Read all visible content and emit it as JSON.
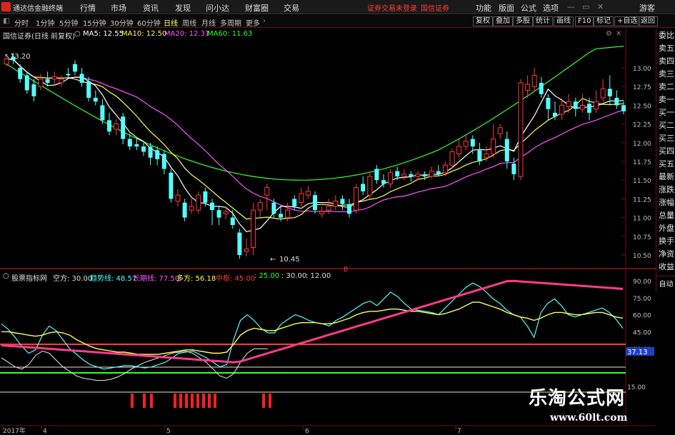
{
  "app": {
    "title": "通达信金融终端",
    "menu": [
      "行情",
      "市场",
      "资讯",
      "发现",
      "问小达",
      "财富圈",
      "交易"
    ],
    "notice_login": "证券交易未登录",
    "notice_broker": "国信证券",
    "right_menu": [
      "功能",
      "版面",
      "公式",
      "选项"
    ],
    "guest": "游客"
  },
  "periods": {
    "items": [
      "分时",
      "1分钟",
      "5分钟",
      "15分钟",
      "30分钟",
      "60分钟",
      "日线",
      "周线",
      "月线",
      "多周期",
      "更多"
    ],
    "active": "日线",
    "buttons": [
      "复权",
      "叠加",
      "多股",
      "统计",
      "画线",
      "F10",
      "标记",
      "+自选",
      "返回"
    ]
  },
  "right_panel": {
    "items": [
      "委比",
      "卖五",
      "卖四",
      "卖三",
      "卖二",
      "卖一",
      "买一",
      "买二",
      "买三",
      "买四",
      "买五",
      "最新",
      "涨跌",
      "涨幅",
      "总量",
      "外盘",
      "换手",
      "净资",
      "收益"
    ],
    "auto": "自动"
  },
  "price_chart": {
    "stock": "国信证券(日线 前复权)",
    "ma5": "MA5: 12.55",
    "ma10": "MA10: 12.50",
    "ma20": "MA20: 12.31",
    "ma60": "MA60: 11.63",
    "high_label": "13.20",
    "low_label": "10.45",
    "marker": "B",
    "y_ticks": [
      "13.00",
      "12.75",
      "12.50",
      "12.25",
      "12.00",
      "11.75",
      "11.50",
      "11.25",
      "11.00",
      "10.75",
      "10.50"
    ],
    "colors": {
      "up": "#ff3b3b",
      "down": "#54ffff",
      "ma5": "#ffffff",
      "ma10": "#ffff55",
      "ma20": "#ff55ff",
      "ma60": "#33ff33"
    }
  },
  "indicator": {
    "name": "股票指标网",
    "kong": "空方: 30.00",
    "trend": "趋势线: 48.57",
    "long": "长期线: 77.50",
    "duo": "多方: 56.18",
    "mid": "中枢: 45.00",
    "v25": ": 25.00",
    "v30": ": 30.00",
    "v12": ": 12.00",
    "y_ticks": [
      "90.00",
      "75.00",
      "60.00",
      "45.00",
      "30.00",
      "15.00"
    ],
    "current": "37.13"
  },
  "x_axis": [
    "2017年",
    "4",
    "5",
    "6",
    "7"
  ],
  "watermark": {
    "title": "乐淘公式网",
    "url": "www.60lt.com"
  }
}
